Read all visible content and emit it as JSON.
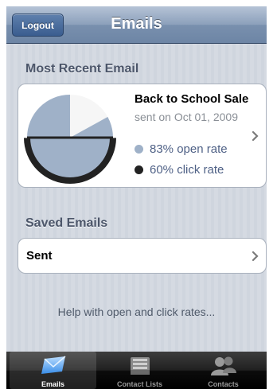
{
  "nav": {
    "title": "Emails",
    "logout_label": "Logout"
  },
  "recent": {
    "section_title": "Most Recent Email",
    "email_name": "Back to School Sale",
    "sent_on": "sent on Oct 01, 2009",
    "open_rate_text": "83% open rate",
    "click_rate_text": "60% click rate",
    "open_rate": 0.83,
    "click_rate": 0.6,
    "open_color": "#9fb1c8",
    "click_color": "#222222"
  },
  "saved": {
    "section_title": "Saved Emails",
    "items": [
      {
        "label": "Sent"
      }
    ]
  },
  "help_text": "Help with open and click rates...",
  "tabbar": {
    "tabs": [
      {
        "label": "Emails",
        "icon": "email-icon",
        "selected": true
      },
      {
        "label": "Contact Lists",
        "icon": "inbox-tray-icon",
        "selected": false
      },
      {
        "label": "Contacts",
        "icon": "people-icon",
        "selected": false
      }
    ]
  }
}
